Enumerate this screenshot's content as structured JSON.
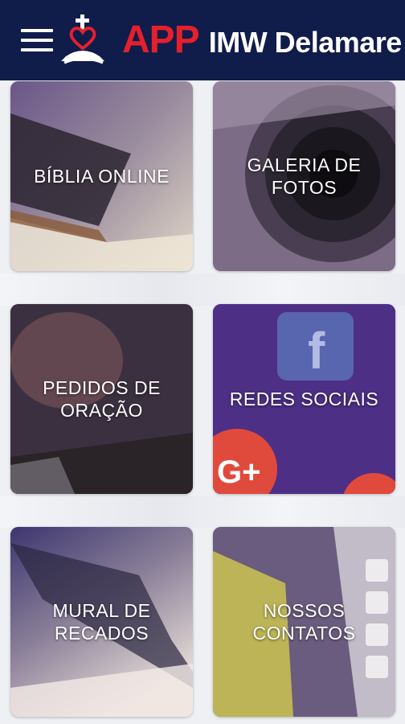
{
  "header": {
    "title_accent": "APP",
    "title_rest": "IMW Delamare",
    "accent_color": "#e4202c",
    "bar_color": "#101c4a",
    "menu_icon": "hamburger-menu-icon",
    "logo_icon": "church-cross-heart-logo"
  },
  "tiles": [
    {
      "label": "BÍBLIA ONLINE"
    },
    {
      "label": "GALERIA DE FOTOS"
    },
    {
      "label": "PEDIDOS DE\nORAÇÃO"
    },
    {
      "label": "REDES SOCIAIS"
    },
    {
      "label": "MURAL DE\nRECADOS"
    },
    {
      "label": "NOSSOS\nCONTATOS"
    }
  ]
}
